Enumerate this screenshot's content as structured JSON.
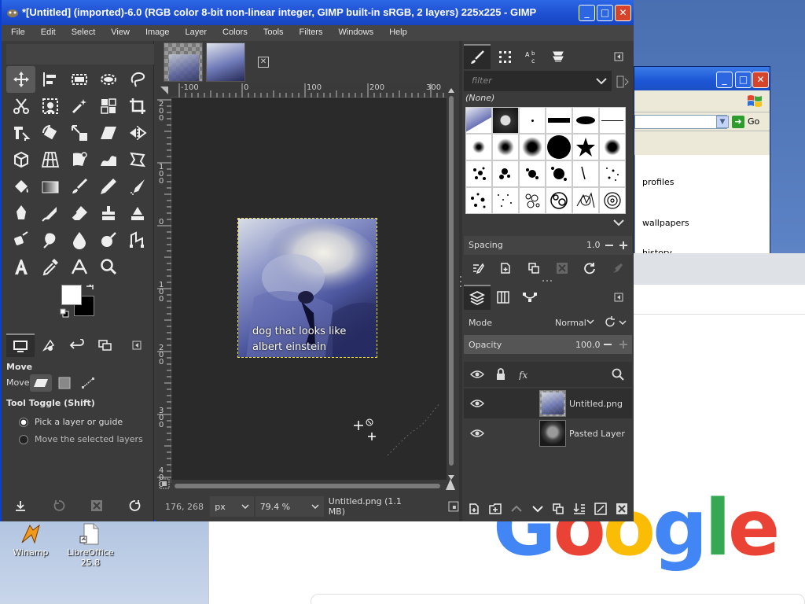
{
  "window": {
    "title": "*[Untitled] (imported)-6.0 (RGB color 8-bit non-linear integer, GIMP built-in sRGB, 2 layers) 225x225 - GIMP",
    "min": "_",
    "max": "□",
    "close": "✕"
  },
  "menu": [
    "File",
    "Edit",
    "Select",
    "View",
    "Image",
    "Layer",
    "Colors",
    "Tools",
    "Filters",
    "Windows",
    "Help"
  ],
  "tool_options": {
    "title": "Move",
    "move_label": "Move:",
    "toggle_title": "Tool Toggle  (Shift)",
    "option1": "Pick a layer or guide",
    "option2": "Move the selected layers"
  },
  "rulers": {
    "h": [
      "-100",
      "0",
      "100",
      "200",
      "300"
    ],
    "v": [
      "200",
      "100",
      "0",
      "100",
      "200",
      "300",
      "400"
    ]
  },
  "image": {
    "caption_line1": "dog that looks like",
    "caption_line2": "albert einstein"
  },
  "status": {
    "coords": "176, 268",
    "unit": "px",
    "zoom": "79.4 %",
    "file": "Untitled.png (1.1 MB)"
  },
  "brushes": {
    "filter_placeholder": "filter",
    "current": "(None)",
    "spacing_label": "Spacing",
    "spacing_value": "1.0"
  },
  "layers": {
    "mode_label": "Mode",
    "mode_value": "Normal",
    "opacity_label": "Opacity",
    "opacity_value": "100.0",
    "items": [
      {
        "name": "Untitled.png"
      },
      {
        "name": "Pasted Layer"
      }
    ]
  },
  "xp_window": {
    "go": "Go",
    "files": [
      "profiles",
      "wallpapers",
      "history"
    ]
  },
  "desktop": {
    "icons": [
      {
        "label": "Winamp"
      },
      {
        "label": "LibreOffice 25.8"
      }
    ]
  },
  "google": {
    "letters": [
      "G",
      "o",
      "o",
      "g",
      "l",
      "e"
    ]
  },
  "colors": {
    "title_blue": "#1e50d2",
    "gimp_bg": "#3b3b3b",
    "selection_dash": "#e8e040"
  }
}
